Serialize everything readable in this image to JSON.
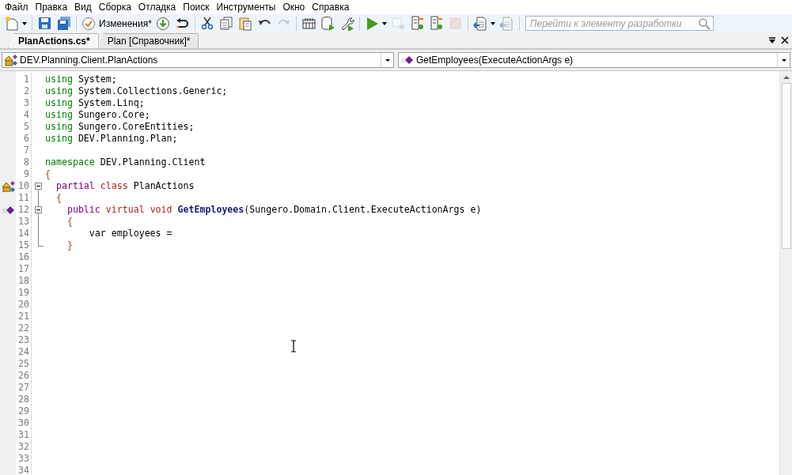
{
  "menu": [
    "Файл",
    "Правка",
    "Вид",
    "Сборка",
    "Отладка",
    "Поиск",
    "Инструменты",
    "Окно",
    "Справка"
  ],
  "toolbar": [
    {
      "kind": "new",
      "disabled": false,
      "dropdown": true
    },
    {
      "kind": "sep"
    },
    {
      "kind": "save",
      "disabled": false
    },
    {
      "kind": "saveall",
      "disabled": false
    },
    {
      "kind": "sep"
    },
    {
      "kind": "check",
      "disabled": false,
      "label": "Изменения*"
    },
    {
      "kind": "download",
      "disabled": false
    },
    {
      "kind": "revert",
      "disabled": false
    },
    {
      "kind": "sep"
    },
    {
      "kind": "cut",
      "disabled": false
    },
    {
      "kind": "copy",
      "disabled": false
    },
    {
      "kind": "paste",
      "disabled": false
    },
    {
      "kind": "undo",
      "disabled": false
    },
    {
      "kind": "redo",
      "disabled": true
    },
    {
      "kind": "sep"
    },
    {
      "kind": "build",
      "disabled": false
    },
    {
      "kind": "database",
      "disabled": false
    },
    {
      "kind": "wrench",
      "disabled": false
    },
    {
      "kind": "sep"
    },
    {
      "kind": "run",
      "disabled": false,
      "dropdown": true
    },
    {
      "kind": "debug",
      "disabled": true
    },
    {
      "kind": "step",
      "disabled": false
    },
    {
      "kind": "step",
      "disabled": false
    },
    {
      "kind": "stop",
      "disabled": true
    },
    {
      "kind": "sep"
    },
    {
      "kind": "doc",
      "disabled": false,
      "dropdown": true
    },
    {
      "kind": "doc",
      "disabled": true
    },
    {
      "kind": "sep"
    }
  ],
  "search": {
    "placeholder": "Перейти к элементу разработки"
  },
  "tabs": [
    {
      "label": "PlanActions.cs*",
      "selected": true
    },
    {
      "label": "Plan [Справочник]*",
      "selected": false
    }
  ],
  "navigation": {
    "type_box": "DEV.Planning.Client.PlanActions",
    "member_box": "GetEmployees(ExecuteActionArgs e)"
  },
  "code_lines": [
    {
      "number": "1",
      "tokens": [
        {
          "kind": "keyword",
          "text": "using"
        },
        {
          "kind": "plain",
          "text": " System;"
        }
      ]
    },
    {
      "number": "2",
      "tokens": [
        {
          "kind": "keyword",
          "text": "using"
        },
        {
          "kind": "plain",
          "text": " System.Collections.Generic;"
        }
      ]
    },
    {
      "number": "3",
      "tokens": [
        {
          "kind": "keyword",
          "text": "using"
        },
        {
          "kind": "plain",
          "text": " System.Linq;"
        }
      ]
    },
    {
      "number": "4",
      "tokens": [
        {
          "kind": "keyword",
          "text": "using"
        },
        {
          "kind": "plain",
          "text": " Sungero.Core;"
        }
      ]
    },
    {
      "number": "5",
      "tokens": [
        {
          "kind": "keyword",
          "text": "using"
        },
        {
          "kind": "plain",
          "text": " Sungero.CoreEntities;"
        }
      ]
    },
    {
      "number": "6",
      "tokens": [
        {
          "kind": "keyword",
          "text": "using"
        },
        {
          "kind": "plain",
          "text": " DEV.Planning.Plan;"
        }
      ]
    },
    {
      "number": "7"
    },
    {
      "number": "8",
      "tokens": [
        {
          "kind": "keyword",
          "text": "namespace"
        },
        {
          "kind": "plain",
          "text": " DEV.Planning.Client"
        }
      ]
    },
    {
      "number": "9",
      "tokens": [
        {
          "kind": "brace",
          "text": "{"
        }
      ]
    },
    {
      "number": "10",
      "kind": "class",
      "expanded": true,
      "tokens": [
        {
          "kind": "modifier",
          "text": "  partial"
        },
        {
          "kind": "typeword",
          "text": " class"
        },
        {
          "kind": "plain",
          "text": " PlanActions"
        }
      ]
    },
    {
      "number": "11",
      "kind": "body",
      "tokens": [
        {
          "kind": "brace",
          "text": "  {"
        }
      ]
    },
    {
      "number": "12",
      "kind": "method",
      "expanded": true,
      "tokens": [
        {
          "kind": "modifier",
          "text": "    public"
        },
        {
          "kind": "typeword",
          "text": " virtual void"
        },
        {
          "kind": "method",
          "text": " GetEmployees"
        },
        {
          "kind": "plain",
          "text": "(Sungero.Domain.Client.ExecuteActionArgs e)"
        }
      ]
    },
    {
      "number": "13",
      "kind": "body",
      "tokens": [
        {
          "kind": "brace",
          "text": "    {"
        }
      ]
    },
    {
      "number": "14",
      "kind": "body",
      "tokens": [
        {
          "kind": "plain",
          "text": "        var employees ="
        }
      ]
    },
    {
      "number": "15",
      "kind": "end",
      "tokens": [
        {
          "kind": "brace",
          "text": "    }"
        }
      ]
    },
    {
      "number": "16"
    },
    {
      "number": "17"
    },
    {
      "number": "18"
    },
    {
      "number": "19"
    },
    {
      "number": "20"
    },
    {
      "number": "21"
    },
    {
      "number": "22"
    },
    {
      "number": "23"
    },
    {
      "number": "24"
    },
    {
      "number": "25"
    },
    {
      "number": "26"
    },
    {
      "number": "27"
    },
    {
      "number": "28"
    },
    {
      "number": "29"
    },
    {
      "number": "30"
    },
    {
      "number": "31"
    },
    {
      "number": "32"
    },
    {
      "number": "33"
    },
    {
      "number": "34"
    }
  ]
}
